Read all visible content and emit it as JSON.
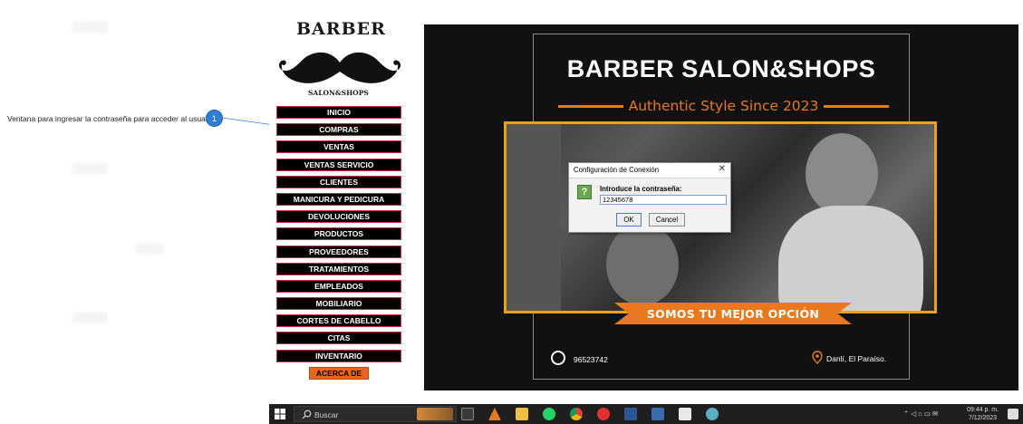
{
  "annotation": {
    "badge": "1",
    "text": "Ventana para ingresar la contraseña para acceder al usuario"
  },
  "sidebar": {
    "logo_title": "BARBER",
    "logo_subtitle": "SALON&SHOPS",
    "menu": [
      {
        "label": "INICIO"
      },
      {
        "label": "COMPRAS"
      },
      {
        "label": "VENTAS"
      },
      {
        "label": "VENTAS SERVICIO"
      },
      {
        "label": "CLIENTES"
      },
      {
        "label": "MANICURA Y PEDICURA"
      },
      {
        "label": "DEVOLUCIONES"
      },
      {
        "label": "PRODUCTOS"
      },
      {
        "label": "PROVEEDORES"
      },
      {
        "label": "TRATAMIENTOS"
      },
      {
        "label": "EMPLEADOS"
      },
      {
        "label": "MOBILIARIO"
      },
      {
        "label": "CORTES DE CABELLO"
      },
      {
        "label": "CITAS"
      },
      {
        "label": "INVENTARIO"
      }
    ],
    "about_label": "ACERCA DE"
  },
  "banner": {
    "title": "BARBER SALON&SHOPS",
    "subtitle": "Authentic Style Since 2023",
    "ribbon": "SOMOS TU MEJOR OPCIÓN",
    "phone": "96523742",
    "location": "Danlí, El Paraíso.",
    "accent_color": "#e8791f",
    "border_color": "#e8a21f"
  },
  "dialog": {
    "title": "Configuración de Conexión",
    "close": "✕",
    "icon": "?",
    "prompt": "Introduce la contraseña:",
    "input_value": "12345678",
    "ok_label": "OK",
    "cancel_label": "Cancel"
  },
  "taskbar": {
    "search_placeholder": "Buscar",
    "time": "09:44 p. m.",
    "date": "7/12/2023",
    "icons": [
      "task-view-icon",
      "vlc-icon",
      "file-explorer-icon",
      "whatsapp-icon",
      "chrome-icon",
      "app-red-icon",
      "word-icon",
      "network-app-icon",
      "java-app-icon",
      "user-app-icon"
    ]
  }
}
